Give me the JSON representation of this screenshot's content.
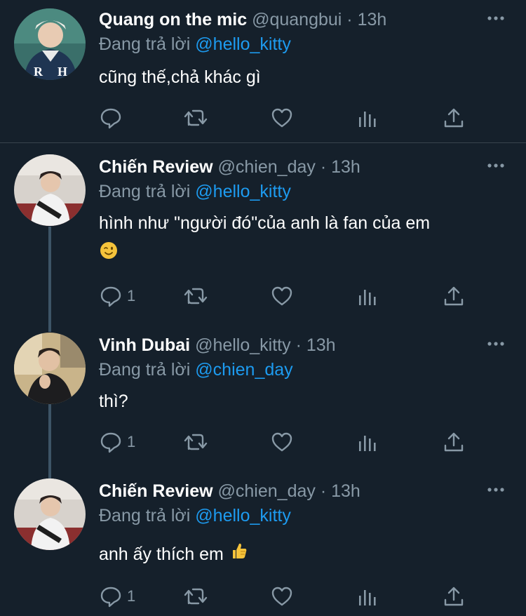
{
  "colors": {
    "background": "#15202b",
    "divider": "#38444d",
    "text": "#ffffff",
    "muted": "#8899a6",
    "link": "#1d9bf0"
  },
  "tweets": [
    {
      "name": "Quang on the mic",
      "handle": "@quangbui",
      "dot": "·",
      "time": "13h",
      "reply_prefix": "Đang trả lời",
      "reply_to": "@hello_kitty",
      "text": "cũng thế,chả khác gì",
      "emoji": "",
      "reply_count": "",
      "icons": [
        "comment-icon",
        "retweet-icon",
        "like-icon",
        "analytics-icon",
        "share-icon",
        "more-icon"
      ]
    },
    {
      "name": "Chiến Review",
      "handle": "@chien_day",
      "dot": "·",
      "time": "13h",
      "reply_prefix": "Đang trả lời",
      "reply_to": "@hello_kitty",
      "text": "hình như \"người đó\"của anh là fan của em",
      "emoji": "winking-face-emoji",
      "reply_count": "1"
    },
    {
      "name": "Vinh Dubai",
      "handle": "@hello_kitty",
      "dot": "·",
      "time": "13h",
      "reply_prefix": "Đang trả lời",
      "reply_to": "@chien_day",
      "text": "thì?",
      "emoji": "",
      "reply_count": "1"
    },
    {
      "name": "Chiến Review",
      "handle": "@chien_day",
      "dot": "·",
      "time": "13h",
      "reply_prefix": "Đang trả lời",
      "reply_to": "@hello_kitty",
      "text": "anh ấy thích em",
      "emoji": "thumbs-up-emoji",
      "reply_count": "1"
    }
  ]
}
